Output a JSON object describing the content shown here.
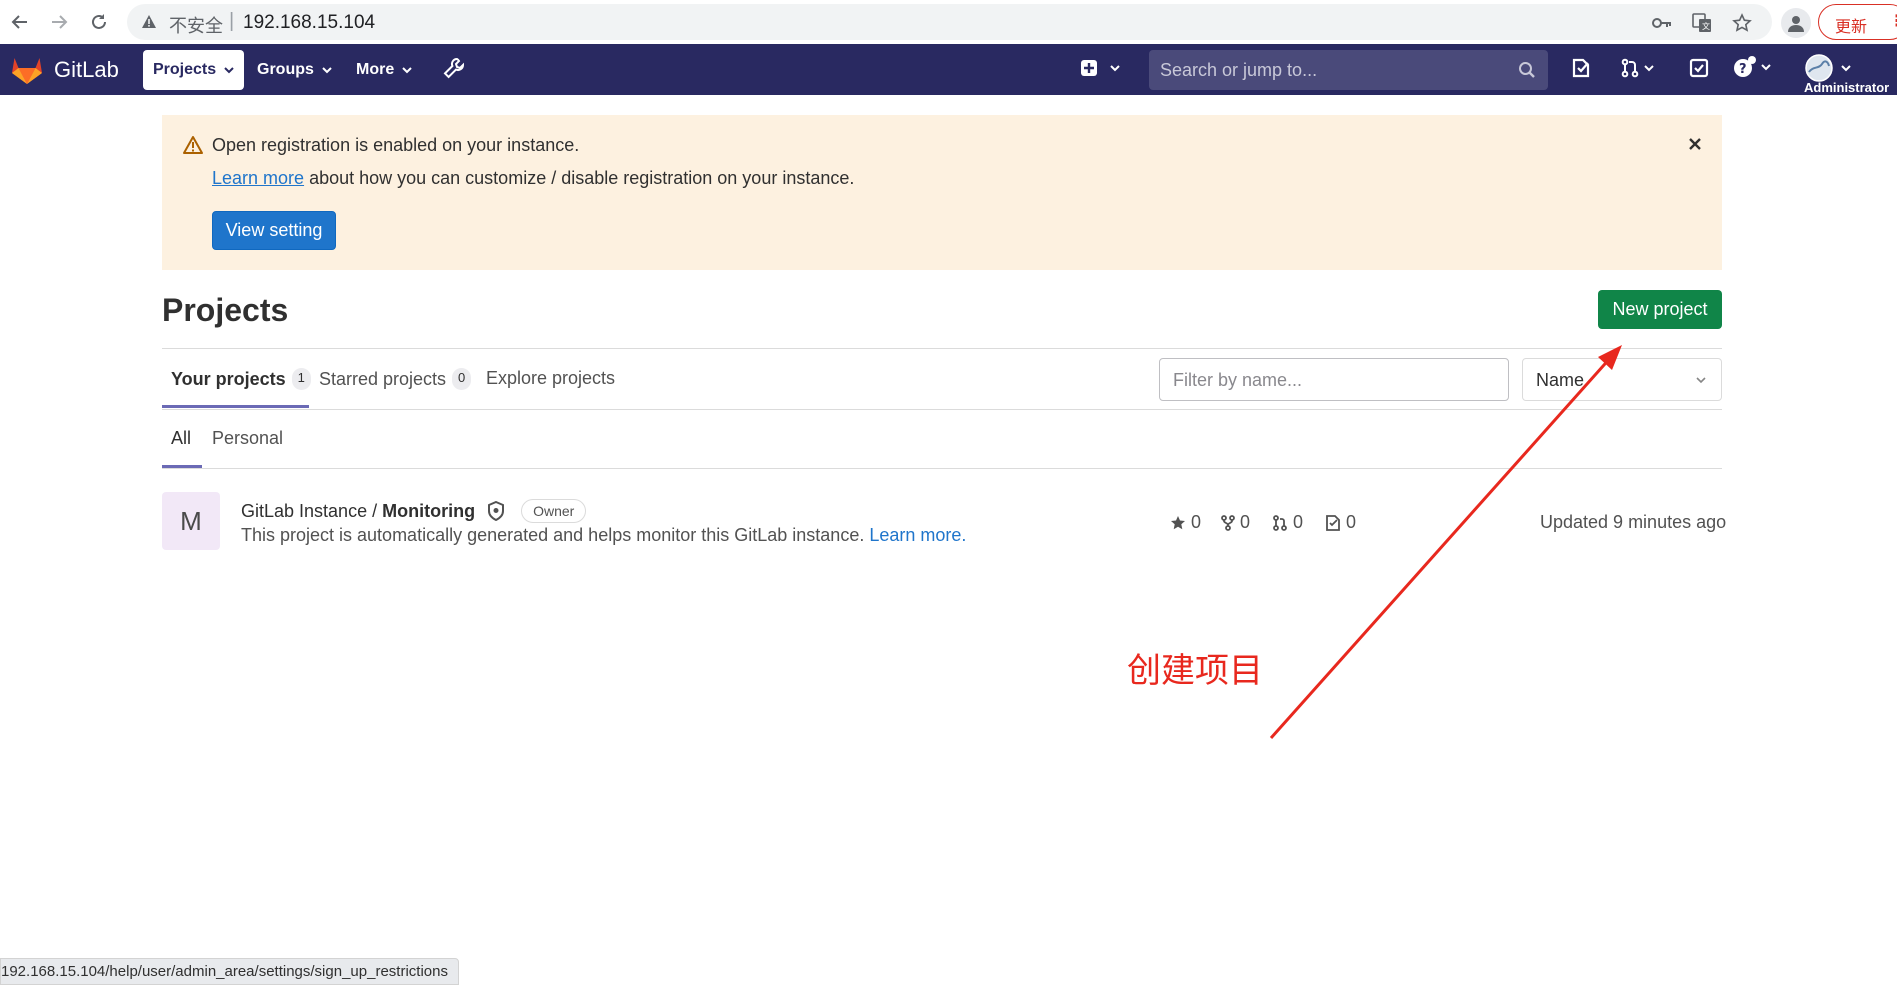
{
  "browser": {
    "insecure_label": "不安全",
    "separator": "|",
    "url": "192.168.15.104",
    "update_label": "更新",
    "status_url": "192.168.15.104/help/user/admin_area/settings/sign_up_restrictions"
  },
  "header": {
    "logo_text": "GitLab",
    "nav": {
      "projects": "Projects",
      "groups": "Groups",
      "more": "More"
    },
    "search_placeholder": "Search or jump to...",
    "user_label": "Administrator"
  },
  "alert": {
    "title": "Open registration is enabled on your instance.",
    "link_text": "Learn more",
    "body_text": " about how you can customize / disable registration on your instance.",
    "button_label": "View setting"
  },
  "page": {
    "title": "Projects",
    "new_project_label": "New project",
    "tabs": [
      {
        "label": "Your projects",
        "count": "1"
      },
      {
        "label": "Starred projects",
        "count": "0"
      },
      {
        "label": "Explore projects"
      }
    ],
    "filter_placeholder": "Filter by name...",
    "sort_value": "Name",
    "subtabs": [
      "All",
      "Personal"
    ]
  },
  "projects": [
    {
      "avatar_letter": "M",
      "namespace": "GitLab Instance / ",
      "name": "Monitoring",
      "role": "Owner",
      "description": "This project is automatically generated and helps monitor this GitLab instance. ",
      "description_link": "Learn more.",
      "stars": "0",
      "forks": "0",
      "merge_requests": "0",
      "issues": "0",
      "updated": "Updated 9 minutes ago"
    }
  ],
  "annotation": {
    "text": "创建项目",
    "color": "#e8281e"
  },
  "colors": {
    "header_bg": "#292961",
    "alert_bg": "#fdf1e0",
    "primary": "#1f75cb",
    "success": "#108548"
  }
}
